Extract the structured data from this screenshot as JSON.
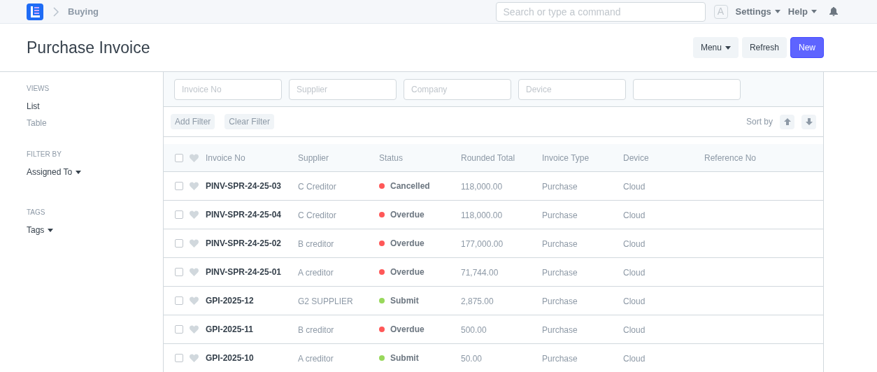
{
  "navbar": {
    "breadcrumb": "Buying",
    "search": {
      "placeholder": "Search or type a command"
    },
    "avatar": "A",
    "menus": [
      "Settings",
      "Help"
    ]
  },
  "page": {
    "title": "Purchase Invoice",
    "buttons": [
      {
        "label": "Menu",
        "kind": "dropdown"
      },
      {
        "label": "Refresh",
        "kind": "default"
      },
      {
        "label": "New",
        "kind": "primary"
      }
    ]
  },
  "sidebar": {
    "sections": [
      {
        "heading": "VIEWS",
        "items": [
          {
            "label": "List",
            "selected": true,
            "kind": "link"
          },
          {
            "label": "Table",
            "selected": false,
            "kind": "link"
          }
        ]
      },
      {
        "heading": "FILTER BY",
        "items": [
          {
            "label": "Assigned To",
            "selected": false,
            "kind": "dropdown"
          }
        ]
      },
      {
        "heading": "TAGS",
        "items": [
          {
            "label": "Tags",
            "selected": false,
            "kind": "dropdown"
          }
        ]
      }
    ]
  },
  "filters": [
    {
      "kind": "text",
      "placeholder": "Invoice No"
    },
    {
      "kind": "text",
      "placeholder": "Supplier"
    },
    {
      "kind": "text",
      "placeholder": "Company"
    },
    {
      "kind": "text",
      "placeholder": "Device"
    },
    {
      "kind": "blank"
    }
  ],
  "filter_buttons": [
    "Add Filter",
    "Clear Filter"
  ],
  "sort": {
    "label": "Sort by"
  },
  "table": {
    "select_all": {
      "checked": false
    },
    "columns": [
      "Invoice No",
      "Supplier",
      "Status",
      "Rounded Total",
      "Invoice Type",
      "Device",
      "Reference No"
    ],
    "rows": [
      {
        "checked": false,
        "invoice_no": "PINV-SPR-24-25-03",
        "supplier": "C Creditor",
        "status": "Cancelled",
        "color": "#ff5858",
        "rounded_total": "118,000.00",
        "invoice_type": "Purchase",
        "device": "Cloud"
      },
      {
        "checked": false,
        "invoice_no": "PINV-SPR-24-25-04",
        "supplier": "C Creditor",
        "status": "Overdue",
        "color": "#ff5858",
        "rounded_total": "118,000.00",
        "invoice_type": "Purchase",
        "device": "Cloud"
      },
      {
        "checked": false,
        "invoice_no": "PINV-SPR-24-25-02",
        "supplier": "B creditor",
        "status": "Overdue",
        "color": "#ff5858",
        "rounded_total": "177,000.00",
        "invoice_type": "Purchase",
        "device": "Cloud"
      },
      {
        "checked": false,
        "invoice_no": "PINV-SPR-24-25-01",
        "supplier": "A creditor",
        "status": "Overdue",
        "color": "#ff5858",
        "rounded_total": "71,744.00",
        "invoice_type": "Purchase",
        "device": "Cloud"
      },
      {
        "checked": false,
        "invoice_no": "GPI-2025-12",
        "supplier": "G2 SUPPLIER",
        "status": "Submit",
        "color": "#98d85b",
        "rounded_total": "2,875.00",
        "invoice_type": "Purchase",
        "device": "Cloud"
      },
      {
        "checked": false,
        "invoice_no": "GPI-2025-11",
        "supplier": "B creditor",
        "status": "Overdue",
        "color": "#ff5858",
        "rounded_total": "500.00",
        "invoice_type": "Purchase",
        "device": "Cloud"
      },
      {
        "checked": false,
        "invoice_no": "GPI-2025-10",
        "supplier": "A creditor",
        "status": "Submit",
        "color": "#98d85b",
        "rounded_total": "50.00",
        "invoice_type": "Purchase",
        "device": "Cloud"
      }
    ]
  }
}
